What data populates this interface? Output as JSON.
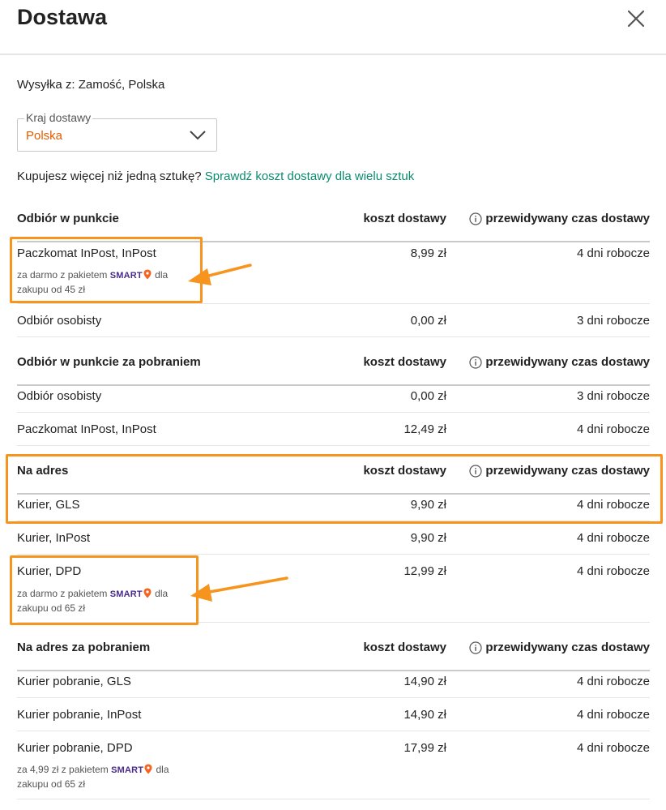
{
  "title": "Dostawa",
  "origin_text": "Wysyłka z: Zamość, Polska",
  "country_select": {
    "legend": "Kraj dostawy",
    "value": "Polska"
  },
  "multi": {
    "question": "Kupujesz więcej niż jedną sztukę? ",
    "link": "Sprawdź koszt dostawy dla wielu sztuk"
  },
  "promo": {
    "free_prefix": "za darmo z pakietem ",
    "smart": "SMART",
    "dla": " dla",
    "from45": "zakupu od 45 zł",
    "from65": "zakupu od 65 zł",
    "price_prefix": "za 4,99 zł z pakietem "
  },
  "sections": [
    {
      "name": "Odbiór w punkcie",
      "cost_header": "koszt dostawy",
      "time_header": "przewidywany czas dostawy",
      "rows": [
        {
          "name": "Paczkomat InPost, InPost",
          "cost": "8,99 zł",
          "time": "4 dni robocze"
        },
        {
          "name": "Odbiór osobisty",
          "cost": "0,00 zł",
          "time": "3 dni robocze"
        }
      ]
    },
    {
      "name": "Odbiór w punkcie za pobraniem",
      "cost_header": "koszt dostawy",
      "time_header": "przewidywany czas dostawy",
      "rows": [
        {
          "name": "Odbiór osobisty",
          "cost": "0,00 zł",
          "time": "3 dni robocze"
        },
        {
          "name": "Paczkomat InPost, InPost",
          "cost": "12,49 zł",
          "time": "4 dni robocze"
        }
      ]
    },
    {
      "name": "Na adres",
      "cost_header": "koszt dostawy",
      "time_header": "przewidywany czas dostawy",
      "rows": [
        {
          "name": "Kurier, GLS",
          "cost": "9,90 zł",
          "time": "4 dni robocze"
        },
        {
          "name": "Kurier, InPost",
          "cost": "9,90 zł",
          "time": "4 dni robocze"
        },
        {
          "name": "Kurier, DPD",
          "cost": "12,99 zł",
          "time": "4 dni robocze"
        }
      ]
    },
    {
      "name": "Na adres za pobraniem",
      "cost_header": "koszt dostawy",
      "time_header": "przewidywany czas dostawy",
      "rows": [
        {
          "name": "Kurier pobranie, GLS",
          "cost": "14,90 zł",
          "time": "4 dni robocze"
        },
        {
          "name": "Kurier pobranie, InPost",
          "cost": "14,90 zł",
          "time": "4 dni robocze"
        },
        {
          "name": "Kurier pobranie, DPD",
          "cost": "17,99 zł",
          "time": "4 dni robocze"
        }
      ]
    }
  ],
  "colors": {
    "accent_orange": "#f7941d",
    "link_green": "#0a8a6e",
    "select_value": "#e65c00",
    "smart_purple": "#4a2a8a",
    "smart_pin": "#f26522"
  }
}
